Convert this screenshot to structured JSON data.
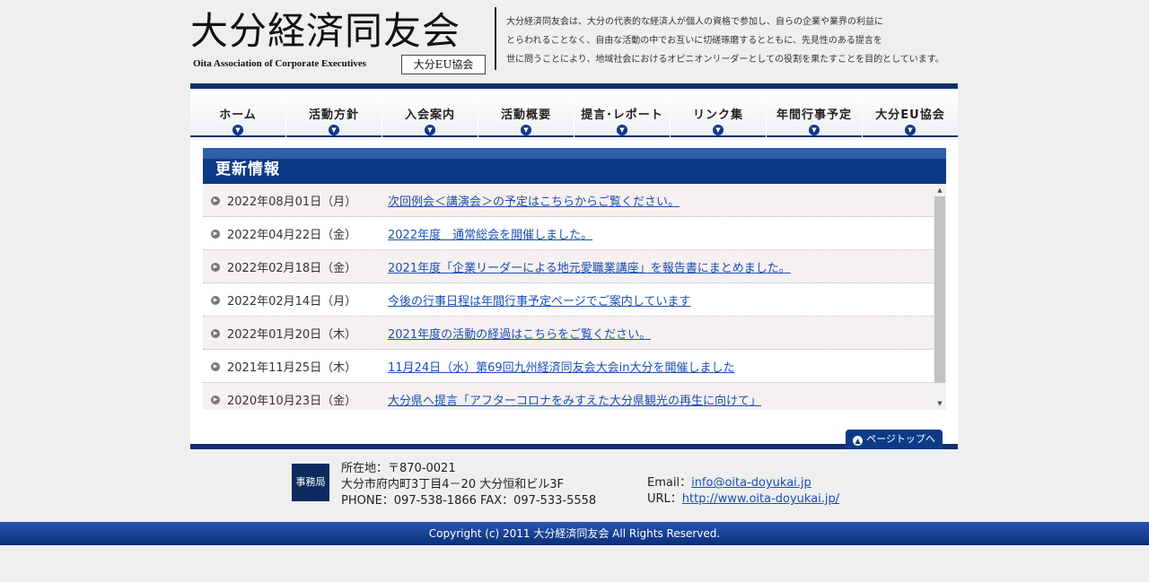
{
  "header": {
    "logo_main": "大分経済同友会",
    "logo_sub": "Oita Association of Corporate Executives",
    "logo_badge": "大分EU協会",
    "intro_lines": [
      "大分経済同友会は、大分の代表的な経済人が個人の資格で参加し、自らの企業や業界の利益に",
      "とらわれることなく、自由な活動の中でお互いに切磋琢磨するとともに、先見性のある提言を",
      "世に問うことにより、地域社会におけるオピニオンリーダーとしての役割を果たすことを目的としています。"
    ]
  },
  "nav": {
    "items": [
      {
        "label": "ホーム"
      },
      {
        "label": "活動方針"
      },
      {
        "label": "入会案内"
      },
      {
        "label": "活動概要"
      },
      {
        "label": "提言･レポート"
      },
      {
        "label": "リンク集"
      },
      {
        "label": "年間行事予定"
      },
      {
        "label": "大分EU協会"
      }
    ]
  },
  "news": {
    "title": "更新情報",
    "items": [
      {
        "date": "2022年08月01日（月）",
        "text": "次回例会＜講演会＞の予定はこちらからご覧ください。"
      },
      {
        "date": "2022年04月22日（金）",
        "text": "2022年度　通常総会を開催しました。"
      },
      {
        "date": "2022年02月18日（金）",
        "text": "2021年度「企業リーダーによる地元愛職業講座」を報告書にまとめました。"
      },
      {
        "date": "2022年02月14日（月）",
        "text": "今後の行事日程は年間行事予定ページでご案内しています"
      },
      {
        "date": "2022年01月20日（木）",
        "text": "2021年度の活動の経過はこちらをご覧ください。"
      },
      {
        "date": "2021年11月25日（木）",
        "text": "11月24日（水）第69回九州経済同友会大会in大分を開催しました"
      },
      {
        "date": "2020年10月23日（金）",
        "text": "大分県へ提言「アフターコロナをみすえた大分県観光の再生に向けて」"
      }
    ]
  },
  "pagetop": {
    "label": "ページトップへ"
  },
  "footer": {
    "office_badge": "事務局",
    "address_lines": [
      "所在地：〒870-0021",
      "大分市府内町3丁目4－20 大分恒和ビル3F",
      "PHONE：097-538-1866 FAX：097-533-5558"
    ],
    "email_label": "Email：",
    "email": "info@oita-doyukai.jp",
    "url_label": "URL：",
    "url": "http://www.oita-doyukai.jp/",
    "copyright": "Copyright (c) 2011 大分経済同友会 All Rights Reserved."
  },
  "colors": {
    "brand_navy": "#0e2f6b",
    "title_bar": "#0c3a86",
    "link": "#1a4fb3",
    "row_alt": "#f7f0f0"
  },
  "icons": {
    "nav_arrow": "chevron-down-circle-icon",
    "news_bullet": "chevron-right-circle-icon",
    "pagetop": "arrow-up-circle-icon"
  }
}
